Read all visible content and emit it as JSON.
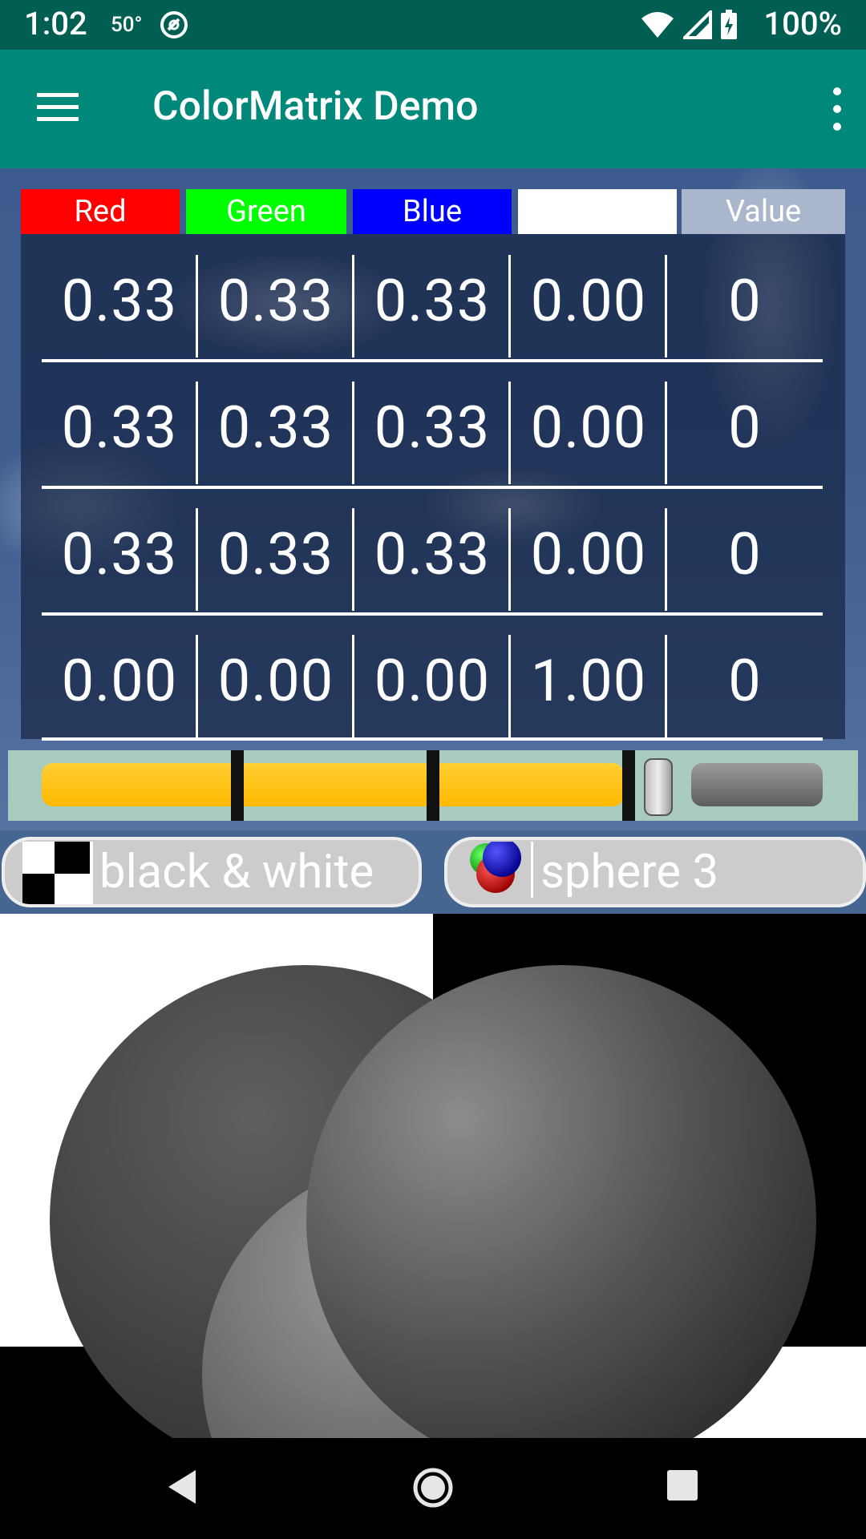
{
  "status_bar": {
    "time": "1:02",
    "temperature": "50°",
    "battery": "100%",
    "icons": [
      "app-status-icon",
      "wifi-icon",
      "cell-signal-icon",
      "battery-charging-icon"
    ]
  },
  "app_bar": {
    "title": "ColorMatrix Demo",
    "menu_icon": "hamburger-menu-icon",
    "overflow_icon": "more-vert-icon",
    "background_color": "#00897b",
    "status_color": "#005f52"
  },
  "matrix": {
    "headers": [
      "Red",
      "Green",
      "Blue",
      "",
      "Value"
    ],
    "header_colors": [
      "#ff0000",
      "#00ff00",
      "#0000ff",
      "#ffffff",
      "#aab6cc"
    ],
    "rows": [
      [
        "0.33",
        "0.33",
        "0.33",
        "0.00",
        "0"
      ],
      [
        "0.33",
        "0.33",
        "0.33",
        "0.00",
        "0"
      ],
      [
        "0.33",
        "0.33",
        "0.33",
        "0.00",
        "0"
      ],
      [
        "0.00",
        "0.00",
        "0.00",
        "1.00",
        "0"
      ]
    ]
  },
  "slider": {
    "value_fraction": 0.78,
    "fill_color": "#ffc107"
  },
  "selectors": {
    "filter_label": "black & white",
    "filter_icon": "checkerboard-icon",
    "image_label": "sphere 3",
    "image_icon": "rgb-spheres-icon"
  },
  "nav_bar": {
    "icons": [
      "back-icon",
      "home-icon",
      "recents-icon"
    ]
  }
}
